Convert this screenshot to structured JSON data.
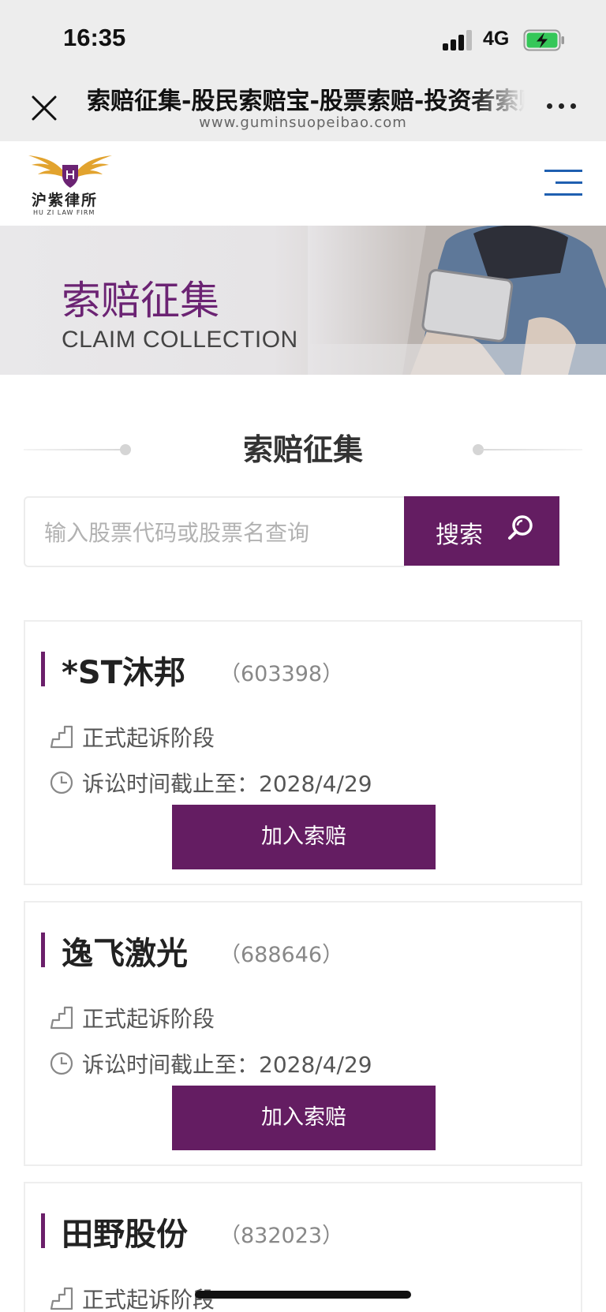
{
  "status_bar": {
    "time": "16:35",
    "network": "4G",
    "icons": [
      "signal-icon",
      "battery-charging-icon"
    ]
  },
  "browser": {
    "title": "索赔征集-股民索赔宝-股票索赔-投资者索赔",
    "url": "www.guminsuopeibao.com",
    "icons": [
      "close-icon",
      "more-icon"
    ]
  },
  "header": {
    "logo_cn": "沪紫律所",
    "logo_en": "HU ZI LAW FIRM",
    "icons": [
      "logo-wings-icon",
      "menu-icon"
    ]
  },
  "banner": {
    "title": "索赔征集",
    "subtitle": "CLAIM COLLECTION"
  },
  "section": {
    "title": "索赔征集"
  },
  "search": {
    "placeholder": "输入股票代码或股票名查询",
    "value": "",
    "button_label": "搜索",
    "icon": "search-icon"
  },
  "cases": [
    {
      "name": "*ST沐邦",
      "code": "（603398）",
      "stage": "正式起诉阶段",
      "deadline": "诉讼时间截止至：2028/4/29",
      "button": "加入索赔"
    },
    {
      "name": "逸飞激光",
      "code": "（688646）",
      "stage": "正式起诉阶段",
      "deadline": "诉讼时间截止至：2028/4/29",
      "button": "加入索赔"
    },
    {
      "name": "田野股份",
      "code": "（832023）",
      "stage": "正式起诉阶段",
      "deadline": "",
      "button": ""
    }
  ],
  "colors": {
    "brand_purple": "#641d62",
    "banner_title": "#6b2373",
    "logo_gold": "#e2a32e"
  }
}
